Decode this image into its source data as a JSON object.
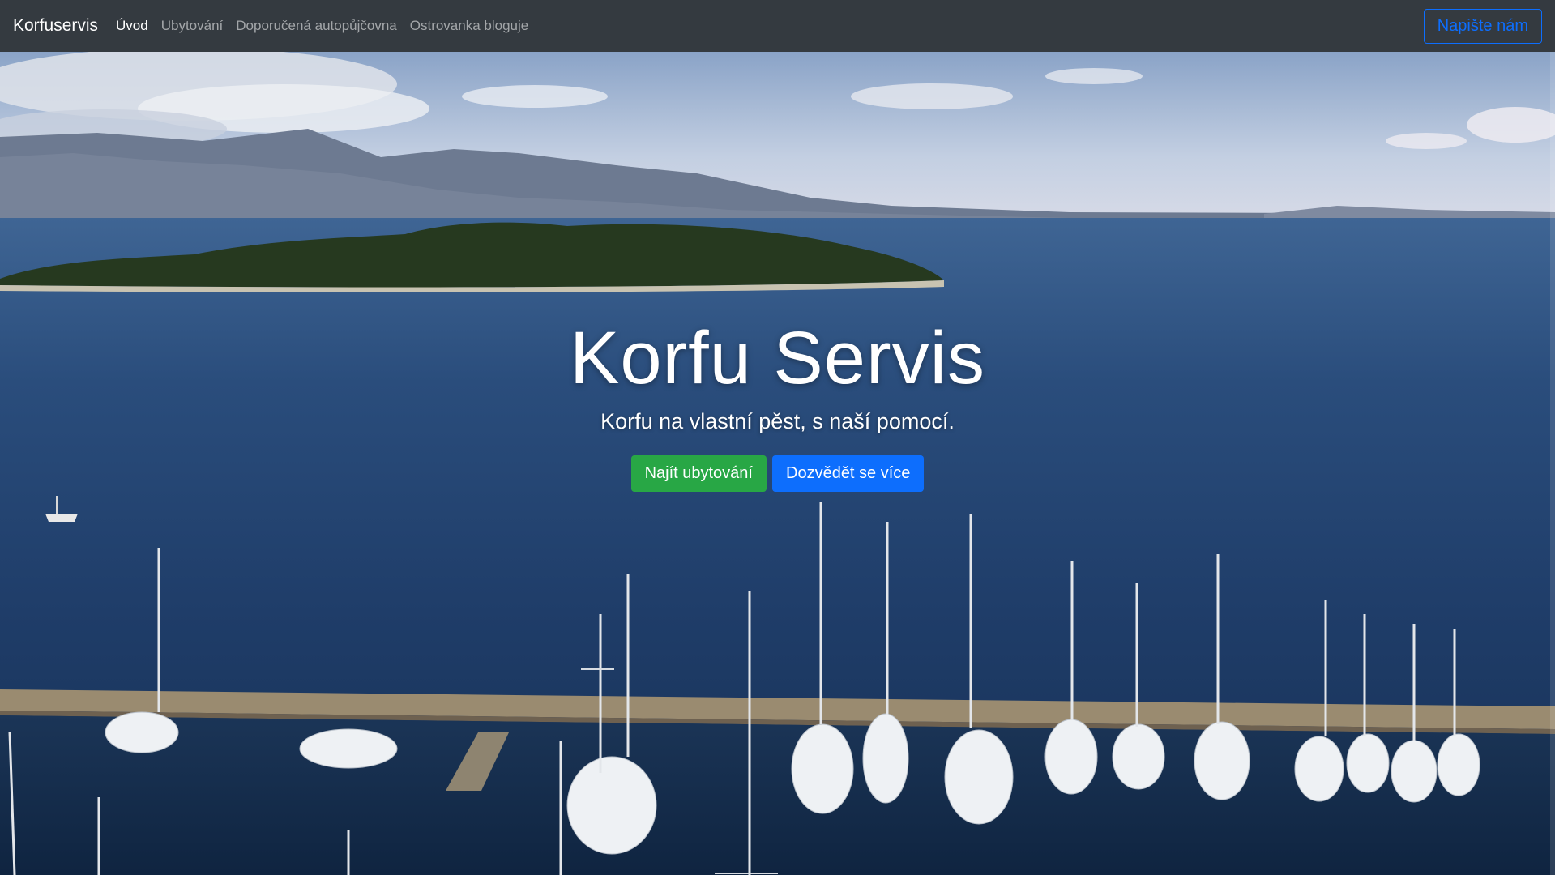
{
  "navbar": {
    "brand": "Korfuservis",
    "links": [
      {
        "label": "Úvod",
        "active": true
      },
      {
        "label": "Ubytování",
        "active": false
      },
      {
        "label": "Doporučená autopůjčovna",
        "active": false
      },
      {
        "label": "Ostrovanka bloguje",
        "active": false
      }
    ],
    "contact_label": "Napište nám"
  },
  "hero": {
    "title": "Korfu Servis",
    "subtitle": "Korfu na vlastní pěst, s naší pomocí.",
    "primary_button": "Najít ubytování",
    "secondary_button": "Dozvědět se více",
    "background_image": "aerial view of Corfu sea, island, mountains and marina with sailboats"
  },
  "colors": {
    "navbar_bg": "#343a40",
    "primary_green": "#28a745",
    "primary_blue": "#0d6efd"
  }
}
